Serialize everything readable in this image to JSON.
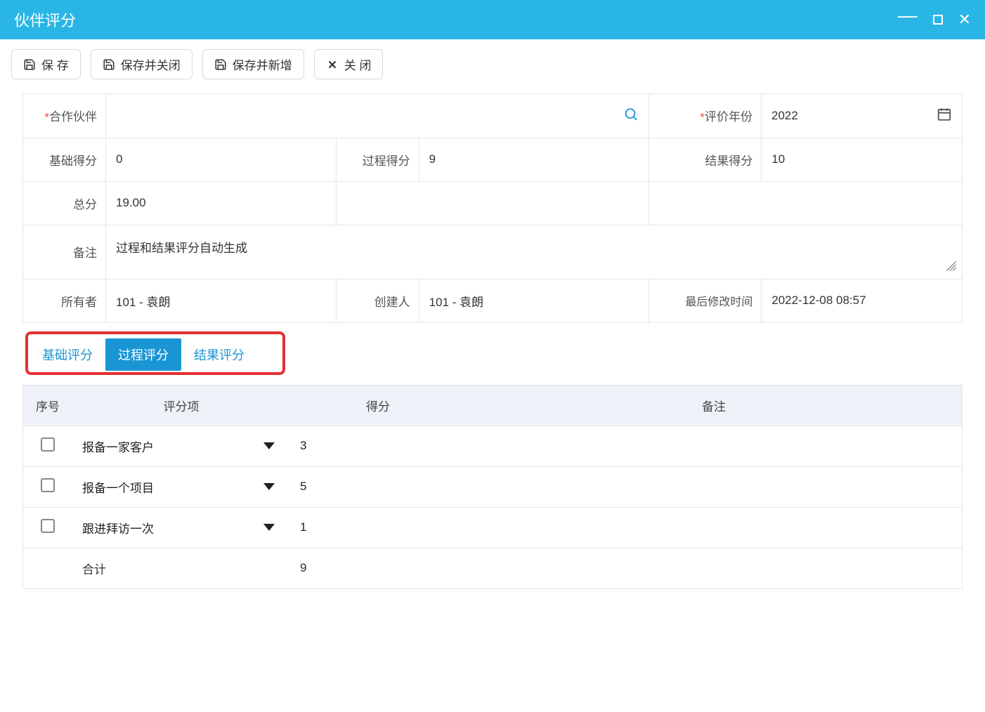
{
  "window": {
    "title": "伙伴评分"
  },
  "toolbar": {
    "save": "保 存",
    "save_close": "保存并关闭",
    "save_new": "保存并新增",
    "close": "关 闭"
  },
  "form": {
    "partner_label": "合作伙伴",
    "partner_value": "",
    "year_label": "评价年份",
    "year_value": "2022",
    "base_label": "基础得分",
    "base_value": "0",
    "process_label": "过程得分",
    "process_value": "9",
    "result_label": "结果得分",
    "result_value": "10",
    "total_label": "总分",
    "total_value": "19.00",
    "remark_label": "备注",
    "remark_value": "过程和结果评分自动生成",
    "owner_label": "所有者",
    "owner_value": "101 - 袁朗",
    "creator_label": "创建人",
    "creator_value": "101 - 袁朗",
    "modtime_label": "最后修改时间",
    "modtime_value": "2022-12-08 08:57"
  },
  "tabs": {
    "items": [
      "基础评分",
      "过程评分",
      "结果评分"
    ],
    "active_index": 1
  },
  "table": {
    "headers": {
      "no": "序号",
      "item": "评分项",
      "score": "得分",
      "note": "备注"
    },
    "rows": [
      {
        "item": "报备一家客户",
        "score": "3",
        "note": ""
      },
      {
        "item": "报备一个项目",
        "score": "5",
        "note": ""
      },
      {
        "item": "跟进拜访一次",
        "score": "1",
        "note": ""
      }
    ],
    "footer": {
      "label": "合计",
      "total": "9"
    }
  }
}
